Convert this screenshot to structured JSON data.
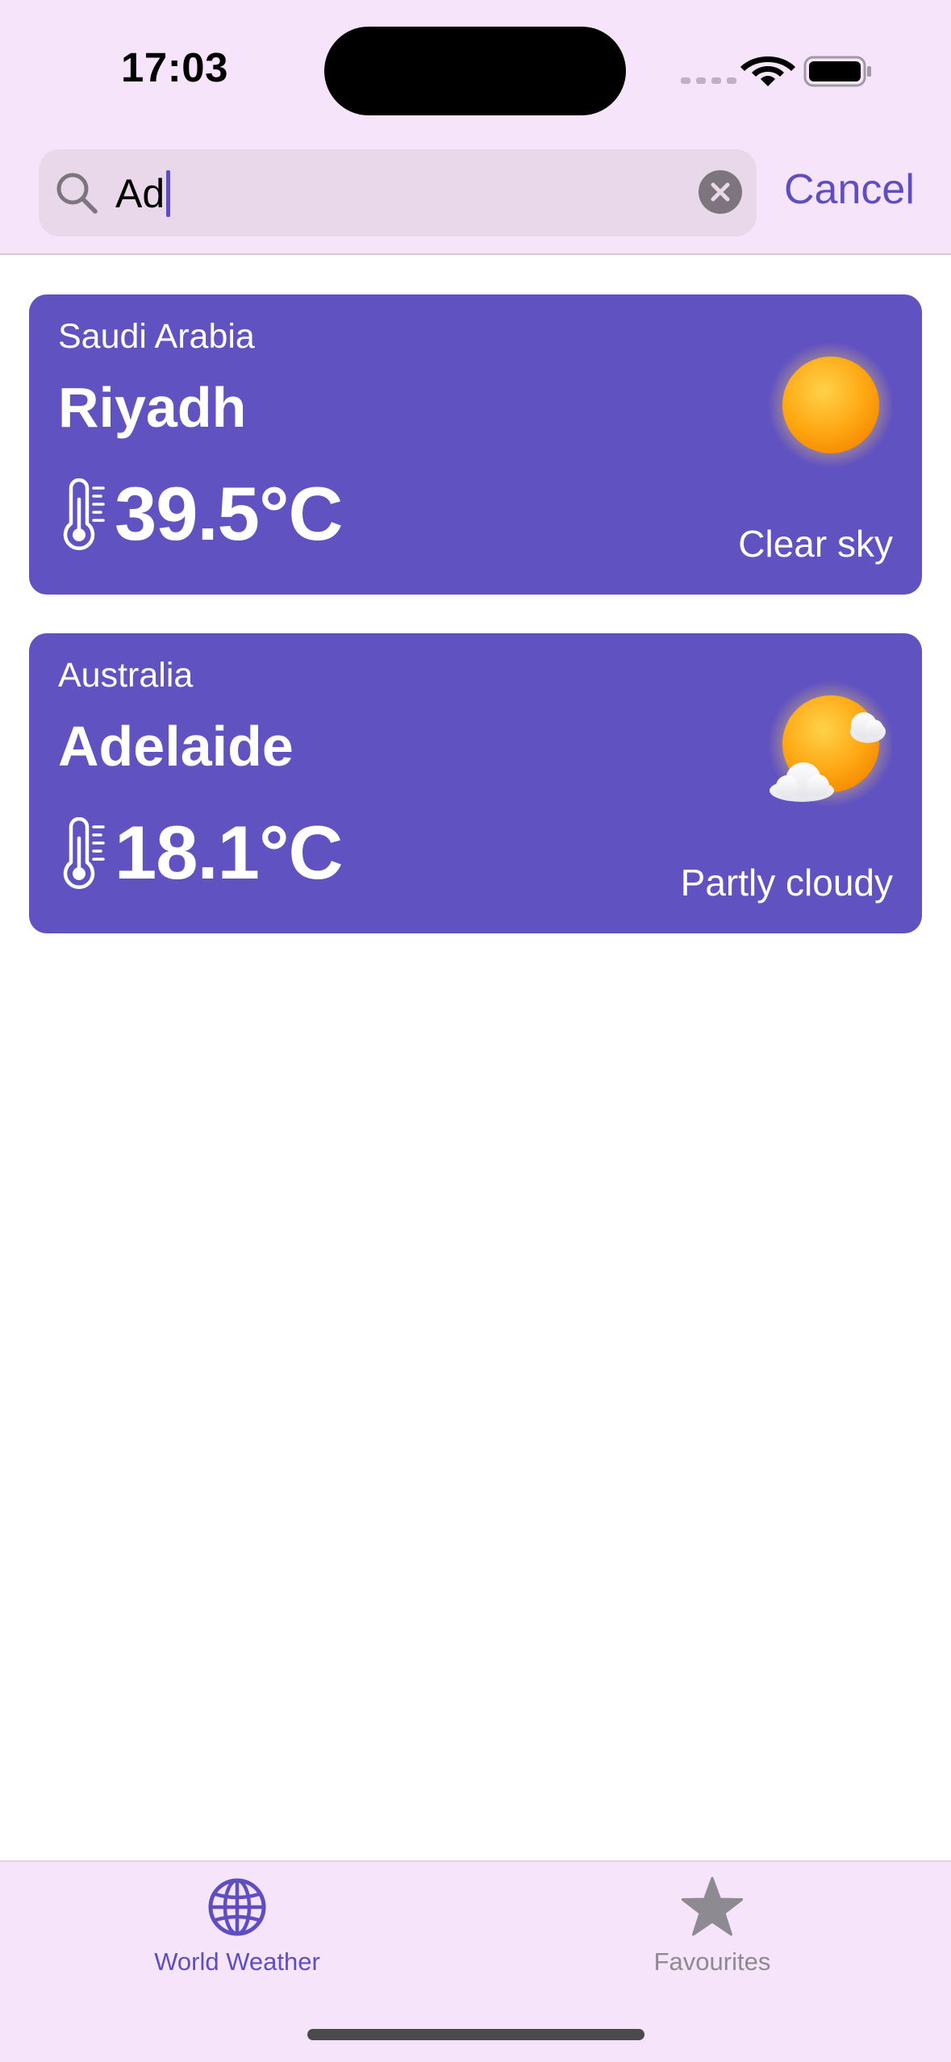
{
  "status_bar": {
    "time": "17:03"
  },
  "search": {
    "value": "Ad",
    "cancel_label": "Cancel"
  },
  "results": [
    {
      "country": "Saudi Arabia",
      "city": "Riyadh",
      "temperature": "39.5°C",
      "condition": "Clear sky",
      "icon": "sun-icon"
    },
    {
      "country": "Australia",
      "city": "Adelaide",
      "temperature": "18.1°C",
      "condition": "Partly cloudy",
      "icon": "partly-cloudy-icon"
    }
  ],
  "tab_bar": {
    "tabs": [
      {
        "label": "World Weather",
        "icon": "globe-icon",
        "selected": true
      },
      {
        "label": "Favourites",
        "icon": "star-icon",
        "selected": false
      }
    ]
  },
  "colors": {
    "accent": "#5f4ec2",
    "card_background": "#6152c1",
    "bar_background": "#f6e5fa",
    "search_field": "#e8d8e9",
    "inactive_tab": "#8e8a91"
  }
}
